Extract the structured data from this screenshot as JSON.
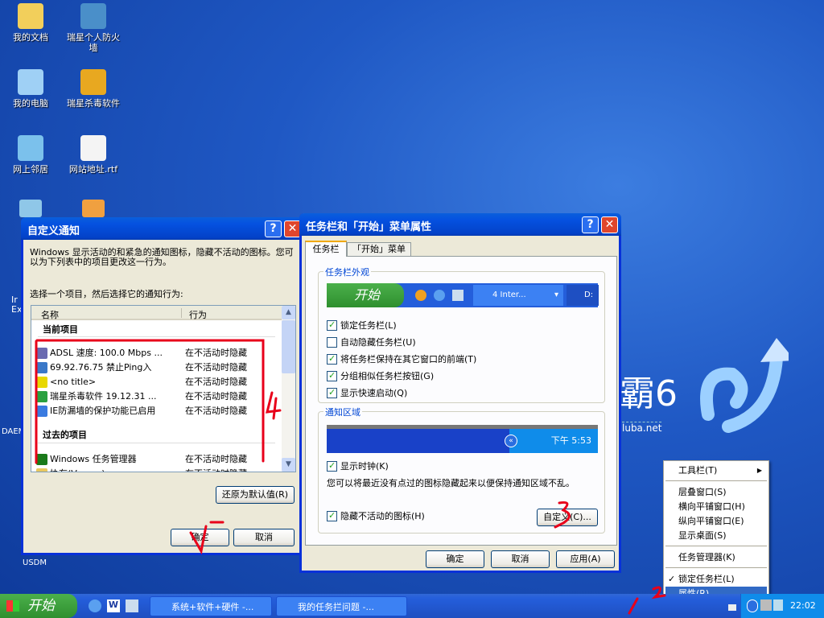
{
  "desktop": {
    "icons": [
      {
        "label": "我的文档",
        "icon": "folder-documents-icon",
        "color": "#f2cf5b"
      },
      {
        "label": "瑞星个人防火墙",
        "icon": "firewall-icon",
        "color": "#4a8fc9"
      },
      {
        "label": "我的电脑",
        "icon": "computer-icon",
        "color": "#9fd0f5"
      },
      {
        "label": "瑞星杀毒软件",
        "icon": "antivirus-lion-icon",
        "color": "#e8a820"
      },
      {
        "label": "网上邻居",
        "icon": "network-icon",
        "color": "#7bc1ec"
      },
      {
        "label": "网站地址.rtf",
        "icon": "rtf-document-icon",
        "color": "#f4f4f4"
      }
    ],
    "edge_labels": [
      "Ir",
      "Ex",
      "DAEM",
      "USDM"
    ],
    "wallpaper_text": {
      "big": "霸6",
      "url": "luba.net"
    }
  },
  "notify_dialog": {
    "title": "自定义通知",
    "intro": "Windows 显示活动的和紧急的通知图标，隐藏不活动的图标。您可以为下列表中的项目更改这一行为。",
    "prompt": "选择一个项目，然后选择它的通知行为:",
    "columns": [
      "名称",
      "行为"
    ],
    "current_header": "当前项目",
    "current_items": [
      {
        "name": "ADSL 速度: 100.0 Mbps ...",
        "behavior": "在不活动时隐藏",
        "color": "#6a6ab0"
      },
      {
        "name": "69.92.76.75 禁止Ping入",
        "behavior": "在不活动时隐藏",
        "color": "#3a78c8"
      },
      {
        "name": "<no title>",
        "behavior": "在不活动时隐藏",
        "color": "#e8d800"
      },
      {
        "name": "瑞星杀毒软件 19.12.31 ...",
        "behavior": "在不活动时隐藏",
        "color": "#2aa040"
      },
      {
        "name": "IE防漏墙的保护功能已启用",
        "behavior": "在不活动时隐藏",
        "color": "#3a7be0"
      }
    ],
    "past_header": "过去的项目",
    "past_items": [
      {
        "name": "Windows 任务管理器",
        "behavior": "在不活动时隐藏",
        "color": "#1a7a1a"
      },
      {
        "name": "协存(Ve... ...)",
        "behavior": "在不活动时隐藏",
        "color": "#e8c860"
      }
    ],
    "restore_button": "还原为默认值(R)",
    "ok": "确定",
    "cancel": "取消"
  },
  "props_dialog": {
    "title": "任务栏和「开始」菜单属性",
    "tabs": [
      {
        "label": "任务栏",
        "active": true
      },
      {
        "label": "「开始」菜单",
        "active": false
      }
    ],
    "appearance_group": "任务栏外观",
    "preview_start": "开始",
    "preview_task": "4 Inter...",
    "preview_folder": "D:",
    "checks": [
      {
        "label": "锁定任务栏(L)",
        "checked": true
      },
      {
        "label": "自动隐藏任务栏(U)",
        "checked": false
      },
      {
        "label": "将任务栏保持在其它窗口的前端(T)",
        "checked": true
      },
      {
        "label": "分组相似任务栏按钮(G)",
        "checked": true
      },
      {
        "label": "显示快速启动(Q)",
        "checked": true
      }
    ],
    "notify_group": "通知区域",
    "preview_clock": "下午 5:53",
    "show_clock": {
      "label": "显示时钟(K)",
      "checked": true
    },
    "hint": "您可以将最近没有点过的图标隐藏起来以便保持通知区域不乱。",
    "hide_inactive": {
      "label": "隐藏不活动的图标(H)",
      "checked": true
    },
    "customize_button": "自定义(C)...",
    "ok": "确定",
    "cancel": "取消",
    "apply": "应用(A)"
  },
  "context_menu": {
    "items": [
      "工具栏(T)",
      "层叠窗口(S)",
      "横向平铺窗口(H)",
      "纵向平铺窗口(E)",
      "显示桌面(S)",
      "任务管理器(K)",
      "锁定任务栏(L)",
      "属性(R)"
    ],
    "checked": "锁定任务栏(L)",
    "highlighted": "属性(R)"
  },
  "taskbar": {
    "start": "开始",
    "tasks": [
      "系统+软件+硬件 -...",
      "我的任务拦问题 -..."
    ],
    "clock": "22:02"
  },
  "annotations": [
    "1",
    "2",
    "3",
    "4",
    "√"
  ],
  "colors": {
    "titlebar": "#0551e0",
    "annotation": "#e8001a",
    "highlight": "#316ac5",
    "taskbar": "#245edb"
  }
}
